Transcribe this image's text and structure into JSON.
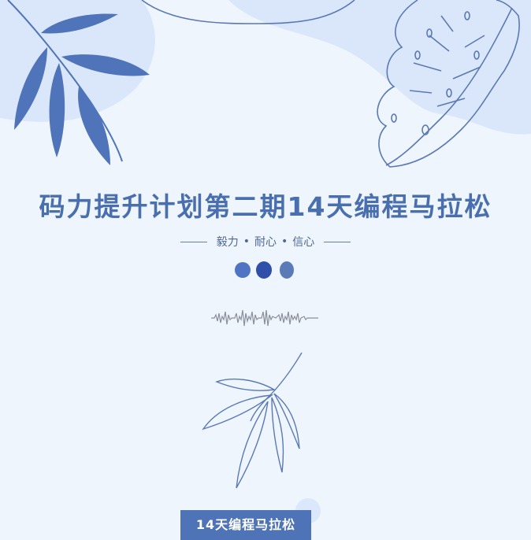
{
  "poster": {
    "title": "码力提升计划第二期14天编程马拉松",
    "motto": {
      "word1": "毅力",
      "separator": "•",
      "word2": "耐心",
      "word3": "信心"
    },
    "badge_text": "14天编程马拉松"
  },
  "colors": {
    "background": "#eef5fd",
    "blob": "#dbe8fb",
    "accent": "#4a6fae",
    "leaf_solid": "#4f74b9",
    "dot1": "#4f74c4",
    "dot2": "#2f4fa9",
    "dot3": "#5a7bb7"
  },
  "decorations": {
    "top_left": "solid-leaf-branch",
    "top_right": "monstera-leaf-outline",
    "middle": "soundwave-line",
    "bottom": "outline-leaf-branch"
  }
}
